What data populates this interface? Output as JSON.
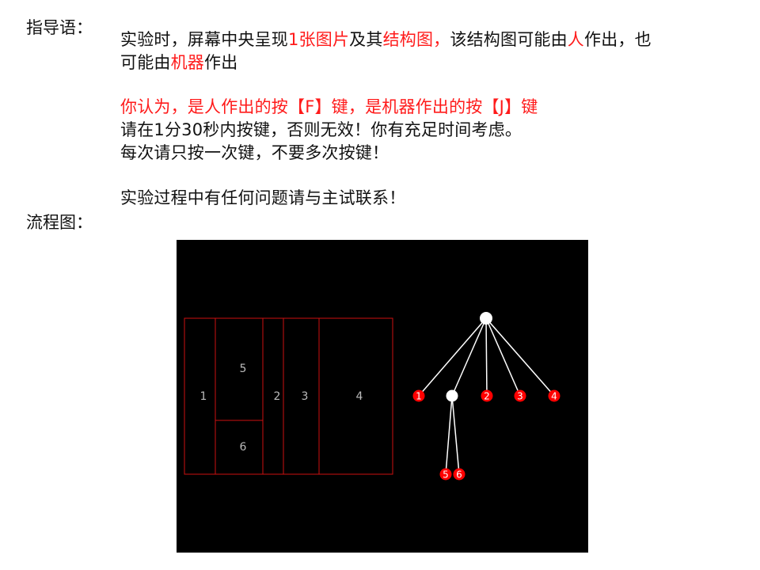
{
  "headings": {
    "instructions": "指导语：",
    "flowchart": "流程图："
  },
  "instructions": {
    "line1": [
      {
        "t": "实验时，屏幕中央呈现",
        "c": "black"
      },
      {
        "t": "1张图片",
        "c": "red"
      },
      {
        "t": "及其",
        "c": "black"
      },
      {
        "t": "结构图，",
        "c": "red"
      },
      {
        "t": "该结构图可能由",
        "c": "black"
      },
      {
        "t": "人",
        "c": "red"
      },
      {
        "t": "作出，也",
        "c": "black"
      }
    ],
    "line2": [
      {
        "t": "可能由",
        "c": "black"
      },
      {
        "t": "机器",
        "c": "red"
      },
      {
        "t": "作出",
        "c": "black"
      }
    ],
    "line3": [
      {
        "t": "你认为，是人作出的按【F】键，是机器作出的按【J】键",
        "c": "red"
      }
    ],
    "line4": [
      {
        "t": "请在1分30秒内按键，否则无效！你有充足时间考虑。",
        "c": "black"
      }
    ],
    "line5": [
      {
        "t": "每次请只按一次键，不要多次按键！",
        "c": "black"
      }
    ],
    "line6": [
      {
        "t": "实验过程中有任何问题请与主试联系！",
        "c": "black"
      }
    ]
  },
  "colors": {
    "accent_red": "#ff1a1a",
    "text": "#111111",
    "figure_bg": "#000000",
    "box_stroke": "#cc1111",
    "box_label": "#bbbbbb",
    "tree_line": "#ffffff",
    "tree_node_red": "#ff0000",
    "tree_root": "#ffffff"
  },
  "figure": {
    "boxes": [
      {
        "id": "1",
        "label": "1"
      },
      {
        "id": "5",
        "label": "5"
      },
      {
        "id": "6",
        "label": "6"
      },
      {
        "id": "2",
        "label": "2"
      },
      {
        "id": "3",
        "label": "3"
      },
      {
        "id": "4",
        "label": "4"
      }
    ],
    "tree_nodes": [
      {
        "id": "n1",
        "label": "1"
      },
      {
        "id": "n2",
        "label": "2"
      },
      {
        "id": "n3",
        "label": "3"
      },
      {
        "id": "n4",
        "label": "4"
      },
      {
        "id": "n5",
        "label": "5"
      },
      {
        "id": "n6",
        "label": "6"
      }
    ]
  }
}
